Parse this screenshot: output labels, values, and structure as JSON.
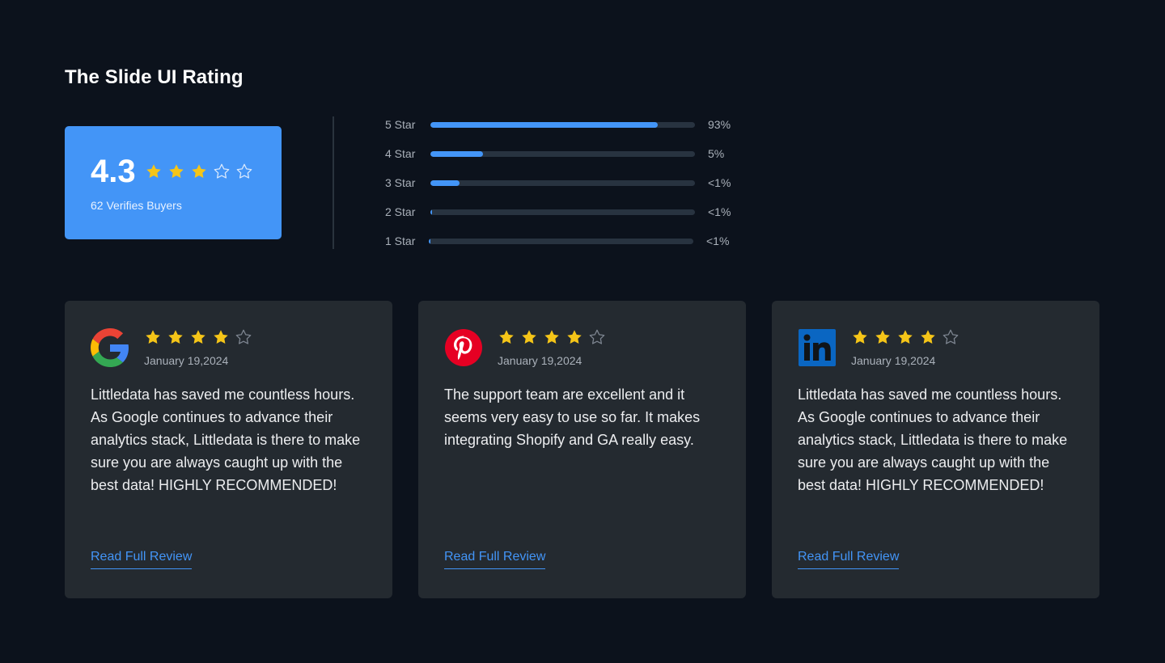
{
  "page": {
    "title": "The Slide UI Rating"
  },
  "summary": {
    "score": "4.3",
    "stars_filled": 3,
    "stars_total": 5,
    "buyers": "62 Verifies Buyers"
  },
  "breakdown": [
    {
      "label": "5 Star",
      "percent_text": "93%",
      "fill_fraction": 0.86
    },
    {
      "label": "4 Star",
      "percent_text": "5%",
      "fill_fraction": 0.2
    },
    {
      "label": "3 Star",
      "percent_text": "<1%",
      "fill_fraction": 0.11
    },
    {
      "label": "2 Star",
      "percent_text": "<1%",
      "fill_fraction": 0.006
    },
    {
      "label": "1 Star",
      "percent_text": "<1%",
      "fill_fraction": 0.006
    }
  ],
  "reviews": [
    {
      "source_icon": "google-logo-icon",
      "stars_filled": 4,
      "date": "January 19,2024",
      "text": "Littledata has saved me countless hours. As Google continues to advance their analytics stack, Littledata is there to make sure you are always caught up with the best data! HIGHLY RECOMMENDED!",
      "link": "Read Full Review"
    },
    {
      "source_icon": "pinterest-logo-icon",
      "stars_filled": 4,
      "date": "January 19,2024",
      "text": "The support team are excellent and it seems very easy to use so far. It makes integrating Shopify and GA really easy.",
      "link": "Read Full Review"
    },
    {
      "source_icon": "linkedin-logo-icon",
      "stars_filled": 4,
      "date": "January 19,2024",
      "text": "Littledata has saved me countless hours. As Google continues to advance their analytics stack, Littledata is there to make sure you are always caught up with the best data! HIGHLY RECOMMENDED!",
      "link": "Read Full Review"
    }
  ],
  "colors": {
    "background": "#0c121c",
    "accent": "#4395f7",
    "star_filled": "#f5c518",
    "card": "#242a30"
  }
}
